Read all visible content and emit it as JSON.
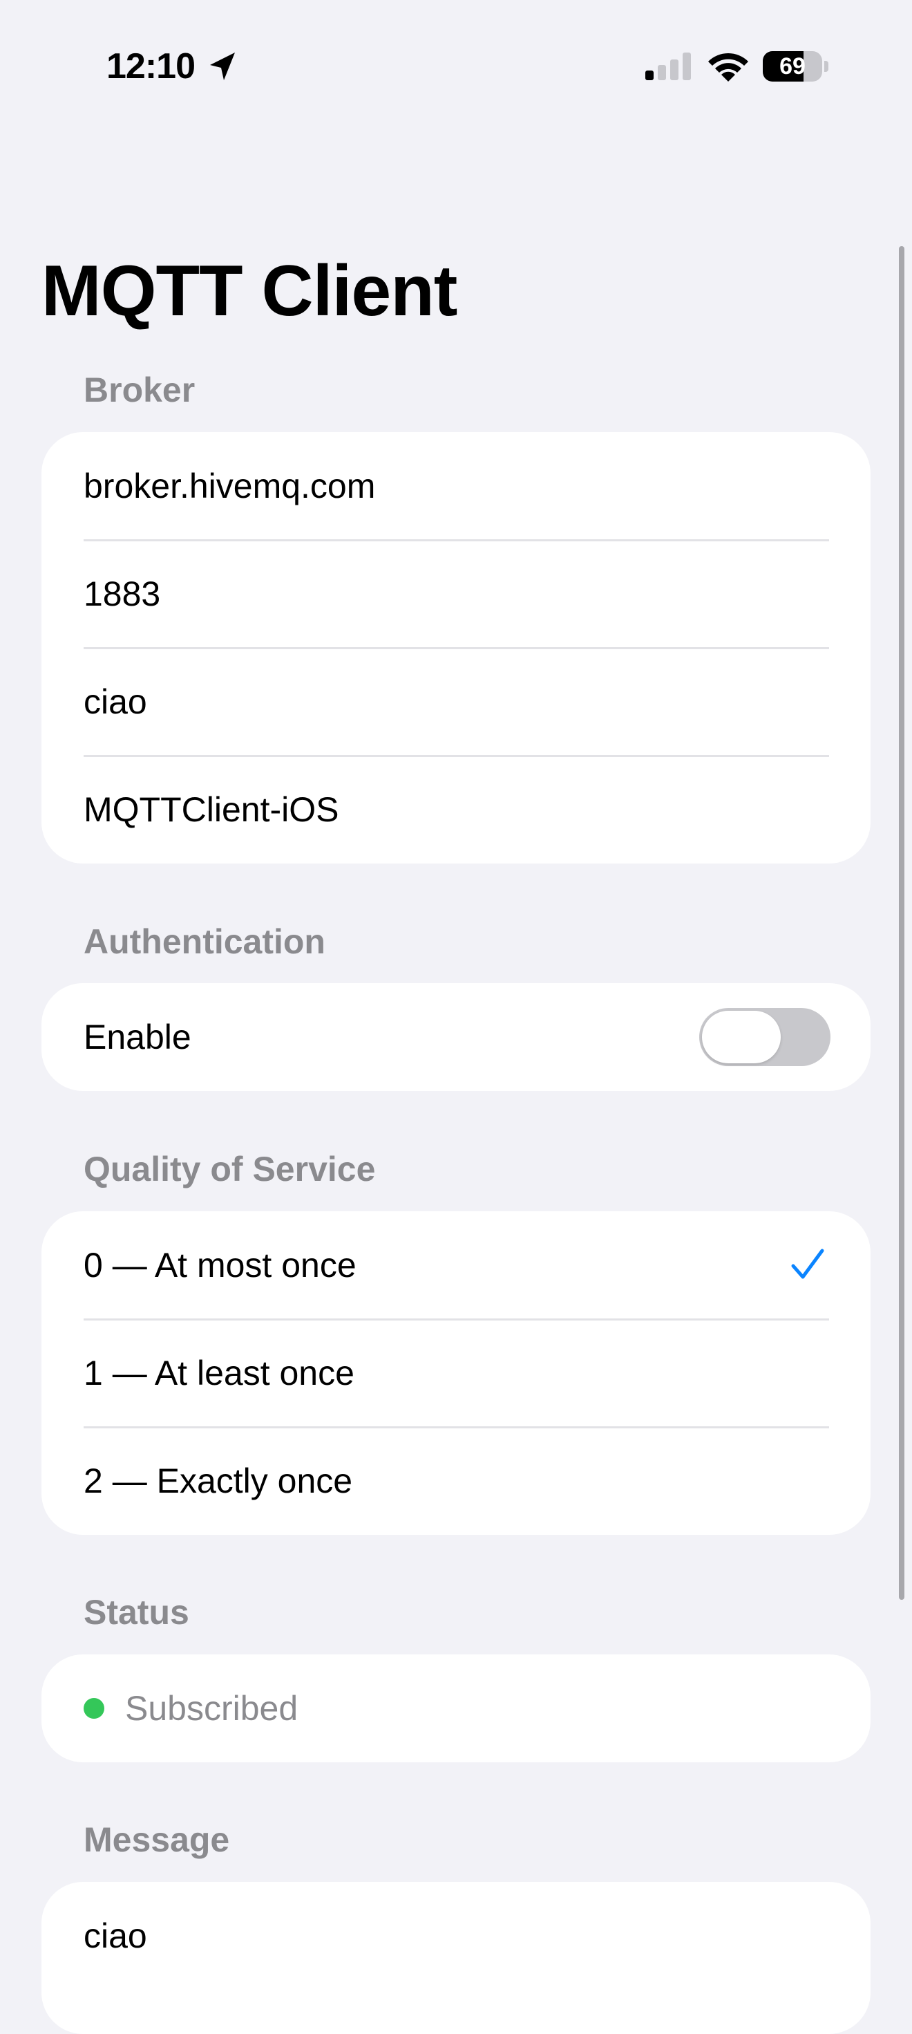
{
  "status_bar": {
    "time": "12:10",
    "battery_level": 69,
    "battery_text": "69"
  },
  "title": "MQTT Client",
  "broker": {
    "header": "Broker",
    "host": "broker.hivemq.com",
    "port": "1883",
    "topic": "ciao",
    "client_id": "MQTTClient-iOS"
  },
  "authentication": {
    "header": "Authentication",
    "enable_label": "Enable",
    "enabled": false
  },
  "qos": {
    "header": "Quality of Service",
    "options": [
      {
        "label": "0 — At most once",
        "selected": true
      },
      {
        "label": "1 — At least once",
        "selected": false
      },
      {
        "label": "2 — Exactly once",
        "selected": false
      }
    ]
  },
  "status": {
    "header": "Status",
    "text": "Subscribed",
    "color": "#34C759"
  },
  "message": {
    "header": "Message",
    "value": "ciao"
  },
  "colors": {
    "accent": "#0A84FF",
    "background": "#F2F2F7",
    "secondary_text": "#8A8A8E"
  }
}
